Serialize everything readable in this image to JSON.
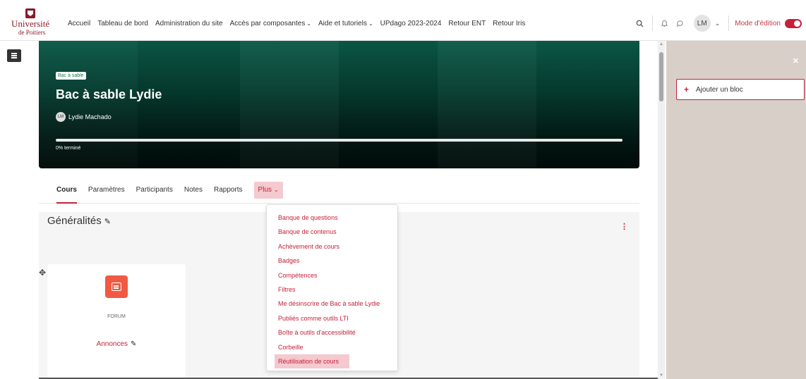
{
  "logo": {
    "line1": "Université",
    "line2": "de Poitiers"
  },
  "topnav": {
    "links": [
      "Accueil",
      "Tableau de bord",
      "Administration du site",
      "Accès par composantes",
      "Aide et tutoriels",
      "UPdago 2023-2024",
      "Retour ENT",
      "Retour Iris"
    ],
    "user_initials": "LM",
    "edit_mode_label": "Mode d'édition",
    "edit_mode_on": true
  },
  "course": {
    "tag": "Bac à sable",
    "title": "Bac à sable Lydie",
    "teacher_initials": "LM",
    "teacher_name": "Lydie Machado",
    "progress_percent": 0,
    "progress_label": "0% terminé"
  },
  "secondary_nav": {
    "tabs": [
      "Cours",
      "Paramètres",
      "Participants",
      "Notes",
      "Rapports"
    ],
    "more_label": "Plus"
  },
  "section": {
    "title": "Généralités"
  },
  "activity": {
    "type": "FORUM",
    "name": "Annonces"
  },
  "more_menu": {
    "items": [
      "Banque de questions",
      "Banque de contenus",
      "Achèvement de cours",
      "Badges",
      "Compétences",
      "Filtres",
      "Me désinscrire de Bac à sable Lydie",
      "Publiés comme outils LTI",
      "Boîte à outils d'accessibilité",
      "Corbeille",
      "Réutilisation de cours"
    ],
    "highlighted_index": 10
  },
  "right_drawer": {
    "add_block_label": "Ajouter un bloc"
  },
  "colors": {
    "accent": "#c6213a",
    "drawer_bg": "#d9cfc9",
    "header_dark": "#053b2f"
  }
}
